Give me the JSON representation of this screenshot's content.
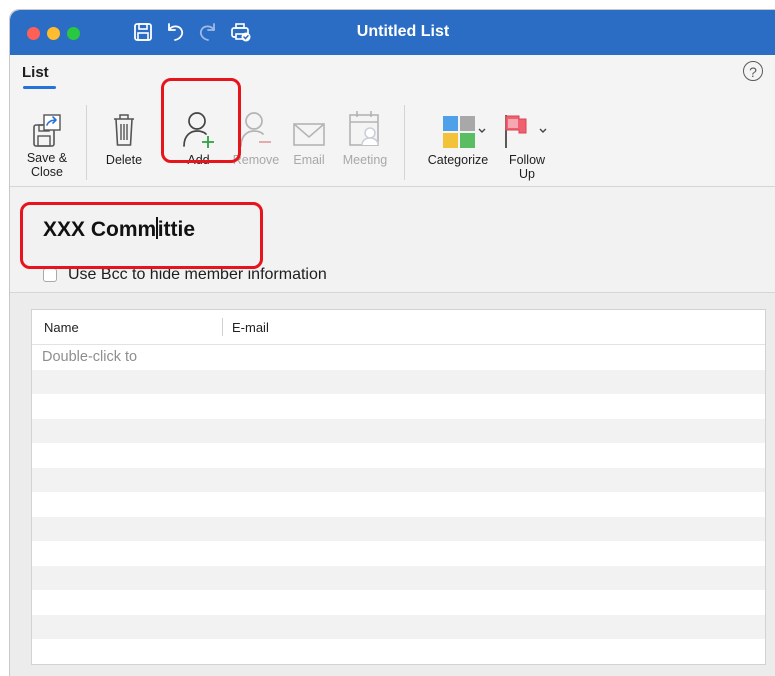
{
  "window": {
    "title": "Untitled List",
    "colors": {
      "titlebar": "#2b6cc4",
      "accent": "#2672d8",
      "highlight": "#e8141b"
    }
  },
  "titlebar_icons": [
    "save-icon",
    "undo-icon",
    "redo-icon",
    "print-icon"
  ],
  "ribbon": {
    "tab": "List",
    "help": "?",
    "buttons": {
      "save_close": "Save &\nClose",
      "delete": "Delete",
      "add": "Add",
      "remove": "Remove",
      "email": "Email",
      "meeting": "Meeting",
      "categorize": "Categorize",
      "follow_up": "Follow\nUp"
    }
  },
  "form": {
    "list_name_before_cursor": "XXX Comm",
    "list_name_after_cursor": "ittie",
    "bcc_label": "Use Bcc to hide member information",
    "bcc_checked": false
  },
  "table": {
    "columns": [
      "Name",
      "E-mail"
    ],
    "placeholder": "Double-click to"
  }
}
